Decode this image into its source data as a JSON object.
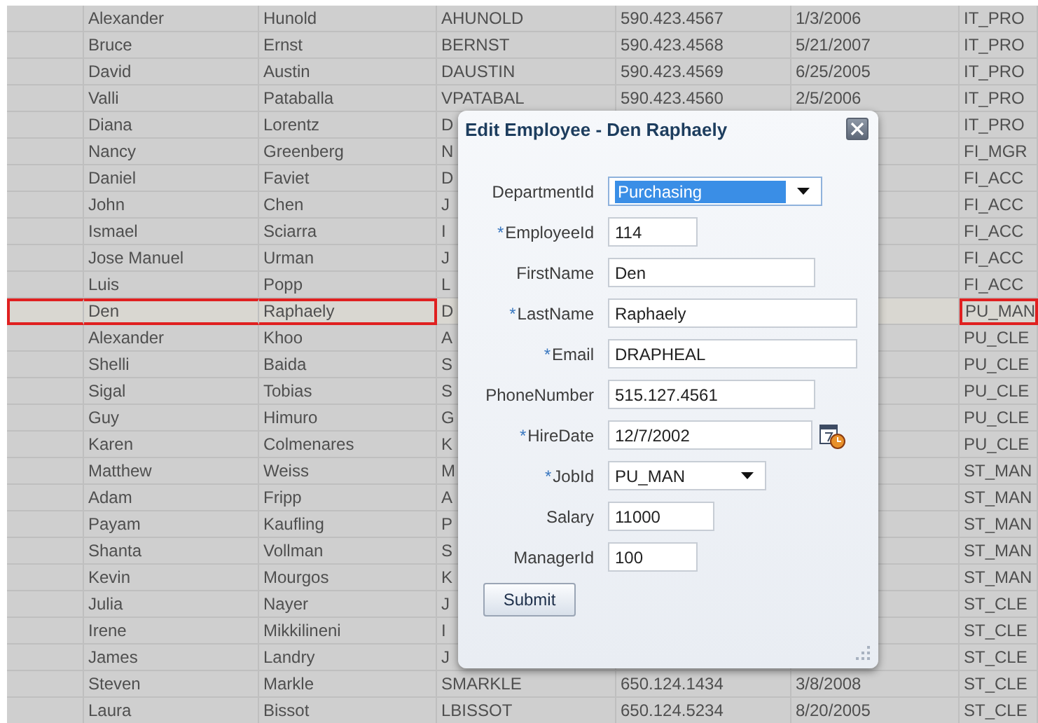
{
  "table": {
    "rows": [
      {
        "cells": [
          "",
          "Alexander",
          "Hunold",
          "AHUNOLD",
          "590.423.4567",
          "1/3/2006",
          "IT_PRO"
        ],
        "selected": false
      },
      {
        "cells": [
          "",
          "Bruce",
          "Ernst",
          "BERNST",
          "590.423.4568",
          "5/21/2007",
          "IT_PRO"
        ],
        "selected": false
      },
      {
        "cells": [
          "",
          "David",
          "Austin",
          "DAUSTIN",
          "590.423.4569",
          "6/25/2005",
          "IT_PRO"
        ],
        "selected": false
      },
      {
        "cells": [
          "",
          "Valli",
          "Pataballa",
          "VPATABAL",
          "590.423.4560",
          "2/5/2006",
          "IT_PRO"
        ],
        "selected": false
      },
      {
        "cells": [
          "",
          "Diana",
          "Lorentz",
          "D",
          "",
          "",
          "IT_PRO"
        ],
        "selected": false
      },
      {
        "cells": [
          "",
          "Nancy",
          "Greenberg",
          "N",
          "",
          "",
          "FI_MGR"
        ],
        "selected": false
      },
      {
        "cells": [
          "",
          "Daniel",
          "Faviet",
          "D",
          "",
          "",
          "FI_ACC"
        ],
        "selected": false
      },
      {
        "cells": [
          "",
          "John",
          "Chen",
          "J",
          "",
          "",
          "FI_ACC"
        ],
        "selected": false
      },
      {
        "cells": [
          "",
          "Ismael",
          "Sciarra",
          "I",
          "",
          "",
          "FI_ACC"
        ],
        "selected": false
      },
      {
        "cells": [
          "",
          "Jose Manuel",
          "Urman",
          "J",
          "",
          "",
          "FI_ACC"
        ],
        "selected": false
      },
      {
        "cells": [
          "",
          "Luis",
          "Popp",
          "L",
          "",
          "",
          "FI_ACC"
        ],
        "selected": false
      },
      {
        "cells": [
          "",
          "Den",
          "Raphaely",
          "D",
          "",
          "",
          "PU_MAN"
        ],
        "selected": true
      },
      {
        "cells": [
          "",
          "Alexander",
          "Khoo",
          "A",
          "",
          "",
          "PU_CLE"
        ],
        "selected": false
      },
      {
        "cells": [
          "",
          "Shelli",
          "Baida",
          "S",
          "",
          "",
          "PU_CLE"
        ],
        "selected": false
      },
      {
        "cells": [
          "",
          "Sigal",
          "Tobias",
          "S",
          "",
          "",
          "PU_CLE"
        ],
        "selected": false
      },
      {
        "cells": [
          "",
          "Guy",
          "Himuro",
          "G",
          "",
          "",
          "PU_CLE"
        ],
        "selected": false
      },
      {
        "cells": [
          "",
          "Karen",
          "Colmenares",
          "K",
          "",
          "",
          "PU_CLE"
        ],
        "selected": false
      },
      {
        "cells": [
          "",
          "Matthew",
          "Weiss",
          "M",
          "",
          "",
          "ST_MAN"
        ],
        "selected": false
      },
      {
        "cells": [
          "",
          "Adam",
          "Fripp",
          "A",
          "",
          "",
          "ST_MAN"
        ],
        "selected": false
      },
      {
        "cells": [
          "",
          "Payam",
          "Kaufling",
          "P",
          "",
          "",
          "ST_MAN"
        ],
        "selected": false
      },
      {
        "cells": [
          "",
          "Shanta",
          "Vollman",
          "S",
          "",
          "",
          "ST_MAN"
        ],
        "selected": false
      },
      {
        "cells": [
          "",
          "Kevin",
          "Mourgos",
          "K",
          "",
          "",
          "ST_MAN"
        ],
        "selected": false
      },
      {
        "cells": [
          "",
          "Julia",
          "Nayer",
          "J",
          "",
          "",
          "ST_CLE"
        ],
        "selected": false
      },
      {
        "cells": [
          "",
          "Irene",
          "Mikkilineni",
          "I",
          "",
          "",
          "ST_CLE"
        ],
        "selected": false
      },
      {
        "cells": [
          "",
          "James",
          "Landry",
          "J",
          "",
          "",
          "ST_CLE"
        ],
        "selected": false
      },
      {
        "cells": [
          "",
          "Steven",
          "Markle",
          "SMARKLE",
          "650.124.1434",
          "3/8/2008",
          "ST_CLE"
        ],
        "selected": false
      },
      {
        "cells": [
          "",
          "Laura",
          "Bissot",
          "LBISSOT",
          "650.124.5234",
          "8/20/2005",
          "ST_CLE"
        ],
        "selected": false
      }
    ]
  },
  "dialog": {
    "title": "Edit Employee - Den Raphaely",
    "fields": [
      {
        "label": "DepartmentId",
        "kind": "select",
        "value": "Purchasing",
        "focused": true
      },
      {
        "label": "EmployeeId",
        "required_mark": "*",
        "kind": "text",
        "value": "114",
        "focused": false
      },
      {
        "label": "FirstName",
        "kind": "text",
        "value": "Den",
        "focused": false
      },
      {
        "label": "LastName",
        "required_mark": "*",
        "kind": "text",
        "value": "Raphaely",
        "focused": false
      },
      {
        "label": "Email",
        "required_mark": "*",
        "kind": "text",
        "value": "DRAPHEAL",
        "focused": false
      },
      {
        "label": "PhoneNumber",
        "kind": "text",
        "value": "515.127.4561",
        "focused": false
      },
      {
        "label": "HireDate",
        "required_mark": "*",
        "kind": "date",
        "value": "12/7/2002",
        "focused": false
      },
      {
        "label": "JobId",
        "required_mark": "*",
        "kind": "select",
        "value": "PU_MAN",
        "focused": false
      },
      {
        "label": "Salary",
        "kind": "text",
        "value": "11000",
        "focused": false
      },
      {
        "label": "ManagerId",
        "kind": "text",
        "value": "100",
        "focused": false
      }
    ],
    "submit": "Submit"
  }
}
